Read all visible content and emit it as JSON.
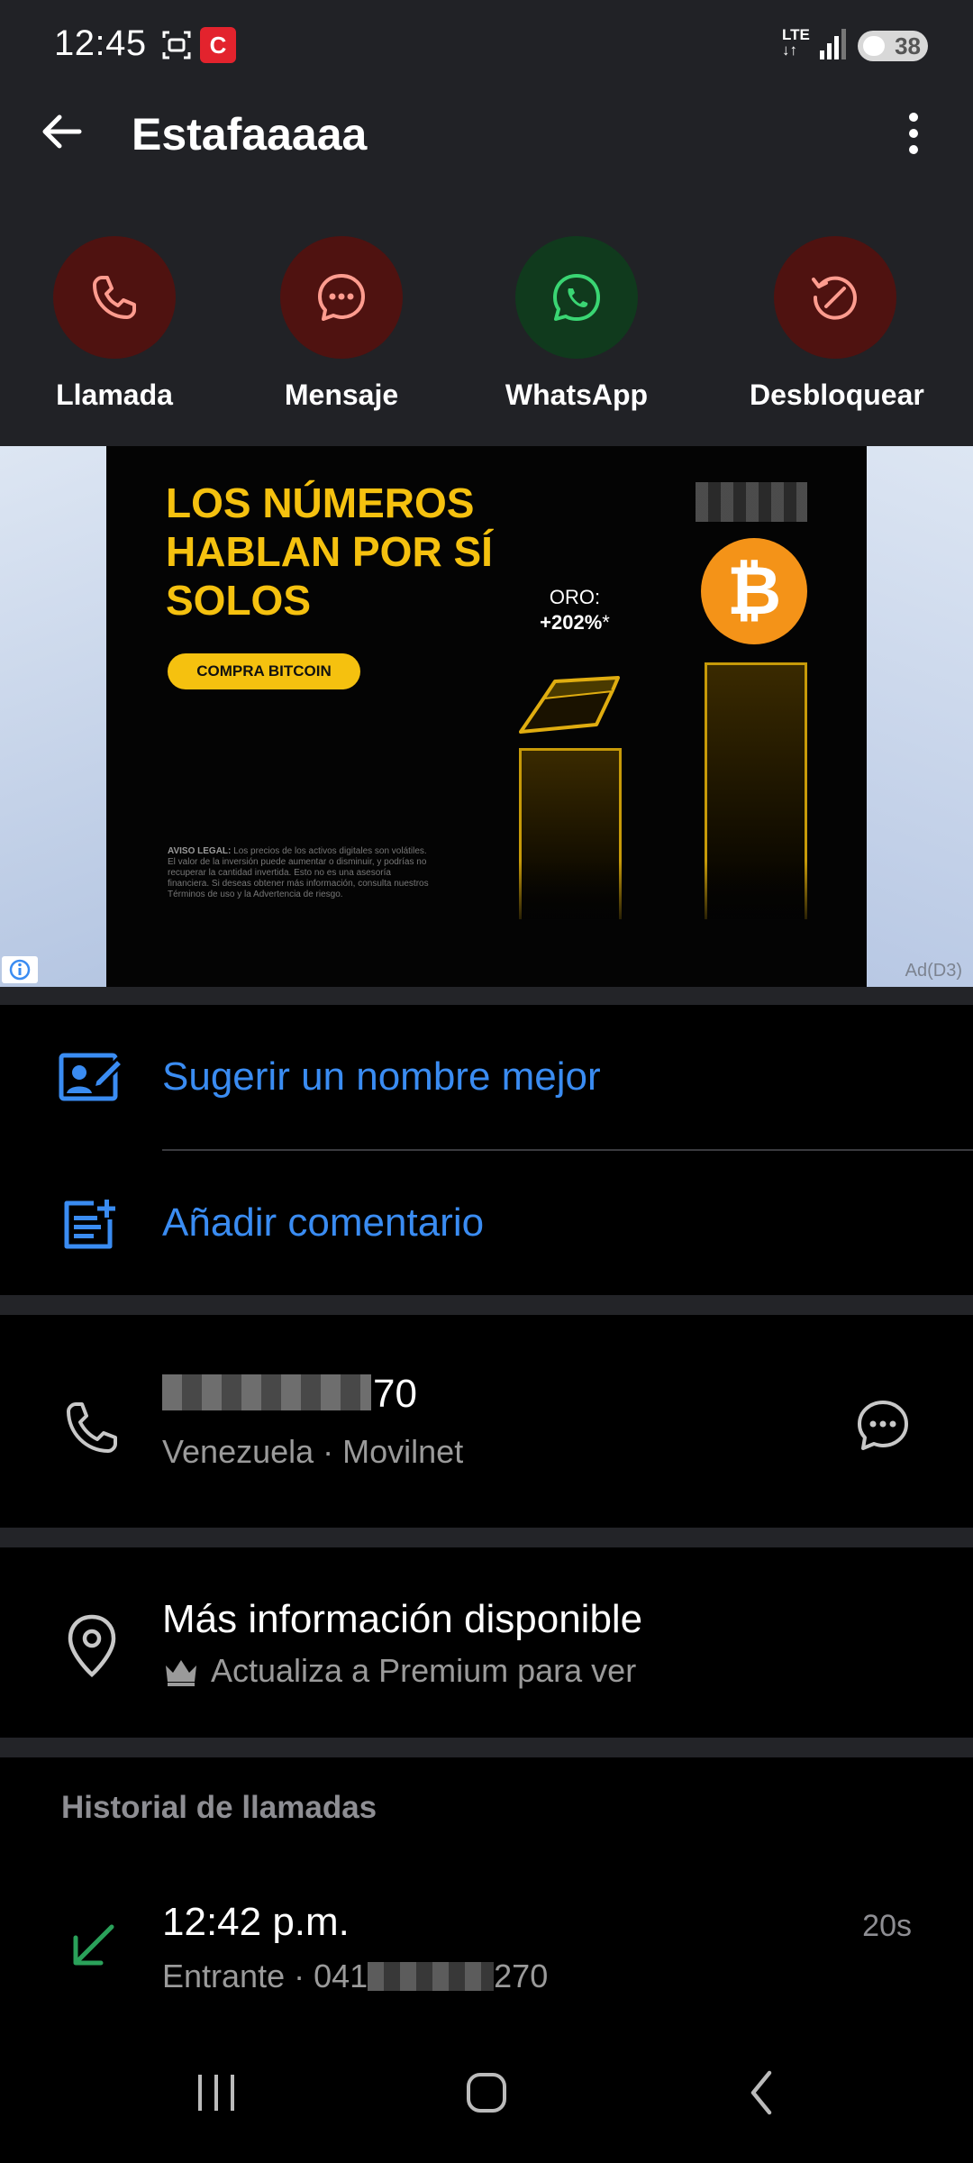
{
  "status_bar": {
    "time": "12:45",
    "network": "LTE",
    "battery": "38",
    "icons": [
      "screenshot-icon",
      "app-notification-icon",
      "signal-icon",
      "battery-icon"
    ]
  },
  "header": {
    "title": "Estafaaaaa",
    "back_icon": "arrow-left-icon",
    "menu_icon": "more-vertical-icon"
  },
  "actions": [
    {
      "label": "Llamada",
      "icon": "phone-icon",
      "color": "#4f1210"
    },
    {
      "label": "Mensaje",
      "icon": "chat-icon",
      "color": "#4f1210"
    },
    {
      "label": "WhatsApp",
      "icon": "whatsapp-icon",
      "color": "#103a1d"
    },
    {
      "label": "Desbloquear",
      "icon": "unblock-icon",
      "color": "#4f1210"
    }
  ],
  "ad": {
    "headline": "LOS NÚMEROS HABLAN POR SÍ SOLOS",
    "cta": "COMPRA BITCOIN",
    "oro_label": "ORO:",
    "oro_value": "+202%",
    "oro_note": "*",
    "coin_symbol": "₿",
    "legal_heading": "AVISO LEGAL:",
    "legal_text": "Los precios de los activos digitales son volátiles. El valor de la inversión puede aumentar o disminuir, y podrías no recuperar la cantidad invertida. Esto no es una asesoría financiera. Si deseas obtener más información, consulta nuestros Términos de uso y la Advertencia de riesgo.",
    "label": "Ad(D3)"
  },
  "suggest": {
    "label": "Sugerir un nombre mejor",
    "icon": "edit-contact-icon"
  },
  "comment": {
    "label": "Añadir comentario",
    "icon": "add-note-icon"
  },
  "phone": {
    "number_visible": "70",
    "carrier": "Venezuela · Movilnet",
    "icon": "phone-icon",
    "message_icon": "chat-icon"
  },
  "info": {
    "title": "Más información disponible",
    "subtitle": "Actualiza a Premium para ver",
    "icon": "location-pin-icon",
    "crown_icon": "crown-icon"
  },
  "history": {
    "title": "Historial de llamadas",
    "calls": [
      {
        "time": "12:42 p.m.",
        "type_prefix": "Entrante · 041",
        "number_suffix": "270",
        "duration": "20s",
        "icon": "incoming-call-icon"
      }
    ]
  },
  "colors": {
    "accent_blue": "#3a8cf2",
    "header_bg": "#212226",
    "incoming_green": "#2aa15a"
  }
}
